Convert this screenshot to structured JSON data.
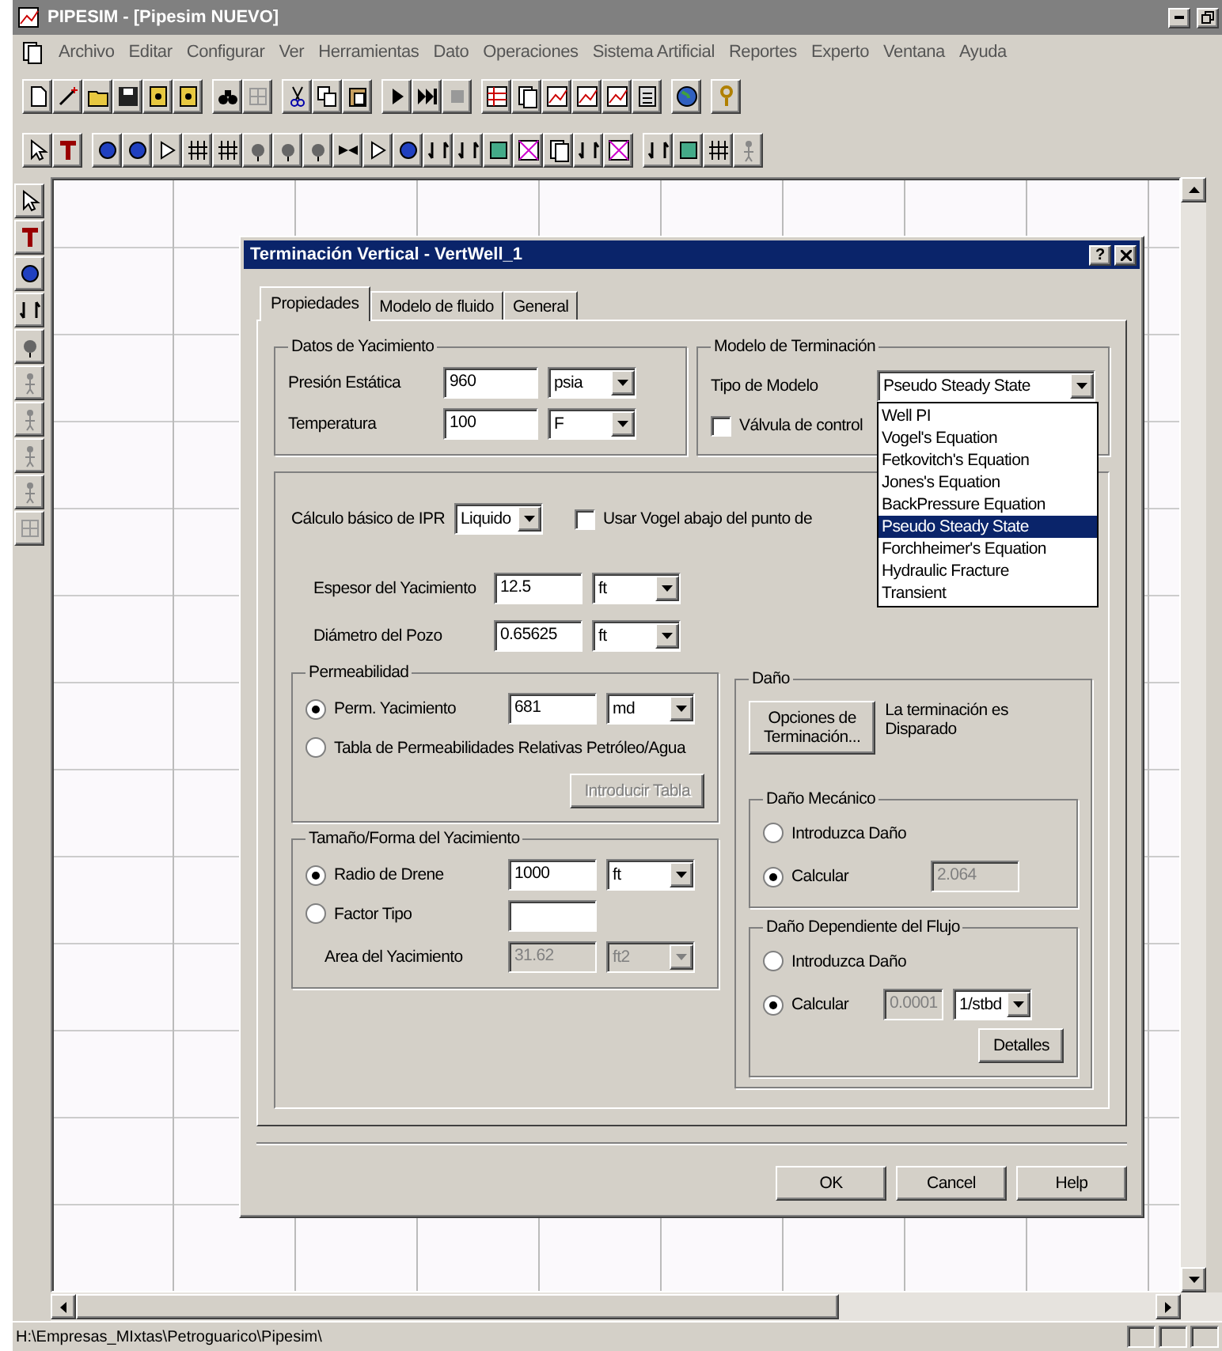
{
  "window": {
    "title": "PIPESIM - [Pipesim NUEVO]"
  },
  "menu": [
    "Archivo",
    "Editar",
    "Configurar",
    "Ver",
    "Herramientas",
    "Dato",
    "Operaciones",
    "Sistema Artificial",
    "Reportes",
    "Experto",
    "Ventana",
    "Ayuda"
  ],
  "dialog": {
    "title": "Terminación Vertical - VertWell_1",
    "help": "?",
    "tabs": [
      {
        "label": "Propiedades",
        "selected": true
      },
      {
        "label": "Modelo de fluido",
        "selected": false
      },
      {
        "label": "General",
        "selected": false
      }
    ],
    "reservoir_data": {
      "title": "Datos de Yacimiento",
      "rows": [
        {
          "label": "Presión Estática",
          "value": "960",
          "unit": "psia"
        },
        {
          "label": "Temperatura",
          "value": "100",
          "unit": "F"
        }
      ]
    },
    "completion_model": {
      "title": "Modelo de Terminación",
      "model_label": "Tipo de Modelo",
      "model_value": "Pseudo Steady State",
      "valve": {
        "label": "Válvula de control",
        "checked": false
      },
      "options": [
        {
          "label": "Well PI",
          "selected": false
        },
        {
          "label": "Vogel's Equation",
          "selected": false
        },
        {
          "label": "Fetkovitch's Equation",
          "selected": false
        },
        {
          "label": "Jones's Equation",
          "selected": false
        },
        {
          "label": "BackPressure Equation",
          "selected": false
        },
        {
          "label": "Pseudo Steady State",
          "selected": true
        },
        {
          "label": "Forchheimer's Equation",
          "selected": false
        },
        {
          "label": "Hydraulic Fracture",
          "selected": false
        },
        {
          "label": "Transient",
          "selected": false
        }
      ]
    },
    "ipr": {
      "label": "Cálculo básico de IPR",
      "value": "Liquido",
      "vogel": {
        "label": "Usar Vogel abajo del punto de",
        "checked": false
      }
    },
    "geometry": [
      {
        "label": "Espesor del Yacimiento",
        "value": "12.5",
        "unit": "ft"
      },
      {
        "label": "Diámetro del Pozo",
        "value": "0.65625",
        "unit": "ft"
      }
    ],
    "permeability": {
      "title": "Permeabilidad",
      "options": [
        {
          "label": "Perm. Yacimiento",
          "selected": true,
          "value": "681",
          "unit": "md"
        },
        {
          "label": "Tabla de Permeabilidades Relativas Petróleo/Agua",
          "selected": false
        }
      ],
      "button": {
        "label": "Introducir Tabla",
        "disabled": true
      }
    },
    "size_shape": {
      "title": "Tamaño/Forma del Yacimiento",
      "options": [
        {
          "label": "Radio de Drene",
          "selected": true,
          "value": "1000",
          "unit": "ft"
        },
        {
          "label": "Factor Tipo",
          "selected": false
        }
      ],
      "area": {
        "label": "Area del Yacimiento",
        "value": "31.62",
        "unit": "ft2",
        "disabled": true
      }
    },
    "damage": {
      "title": "Daño",
      "button": "Opciones de Terminación...",
      "note": "La terminación es Disparado",
      "mechanical": {
        "title": "Daño Mecánico",
        "options": [
          {
            "label": "Introduzca Daño",
            "selected": false
          },
          {
            "label": "Calcular",
            "selected": true
          }
        ],
        "value": "2.064",
        "disabled": true
      },
      "flow": {
        "title": "Daño Dependiente del Flujo",
        "options": [
          {
            "label": "Introduzca Daño",
            "selected": false
          },
          {
            "label": "Calcular",
            "selected": true
          }
        ],
        "value": "0.0001",
        "disabled": true,
        "unit": "1/stbd",
        "button": "Detalles"
      }
    },
    "buttons": [
      "OK",
      "Cancel",
      "Help"
    ]
  },
  "status_bar": {
    "path": "H:\\Empresas_MIxtas\\Petroguarico\\Pipesim\\"
  }
}
